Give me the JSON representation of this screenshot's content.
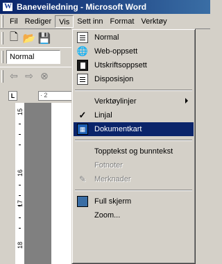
{
  "window": {
    "title": "Baneveiledning - Microsoft Word"
  },
  "menubar": {
    "items": [
      {
        "label": "Fil"
      },
      {
        "label": "Rediger"
      },
      {
        "label": "Vis"
      },
      {
        "label": "Sett inn"
      },
      {
        "label": "Format"
      },
      {
        "label": "Verktøy"
      }
    ]
  },
  "toolbar": {
    "style_value": "Normal",
    "tab_selector": "L",
    "hruler_label": "· 2"
  },
  "vruler": {
    "numbers": [
      "15",
      "16",
      "17",
      "18"
    ]
  },
  "view_menu": {
    "items": [
      {
        "label": "Normal",
        "icon": "normal-view-icon"
      },
      {
        "label": "Web-oppsett",
        "icon": "web-layout-icon"
      },
      {
        "label": "Utskriftsoppsett",
        "icon": "print-layout-icon"
      },
      {
        "label": "Disposisjon",
        "icon": "outline-view-icon"
      },
      {
        "label": "Verktøylinjer",
        "has_submenu": true
      },
      {
        "label": "Linjal",
        "checked": true,
        "icon": "checkmark-icon"
      },
      {
        "label": "Dokumentkart",
        "icon": "document-map-icon",
        "selected": true
      },
      {
        "label": "Topptekst og bunntekst"
      },
      {
        "label": "Fotnoter",
        "disabled": true
      },
      {
        "label": "Merknader",
        "disabled": true,
        "icon": "comments-icon"
      },
      {
        "label": "Full skjerm",
        "icon": "full-screen-icon"
      },
      {
        "label": "Zoom..."
      }
    ]
  },
  "colors": {
    "selection": "#0a246a",
    "face": "#d4d0c8",
    "title_gradient_end": "#3a6ea5"
  }
}
